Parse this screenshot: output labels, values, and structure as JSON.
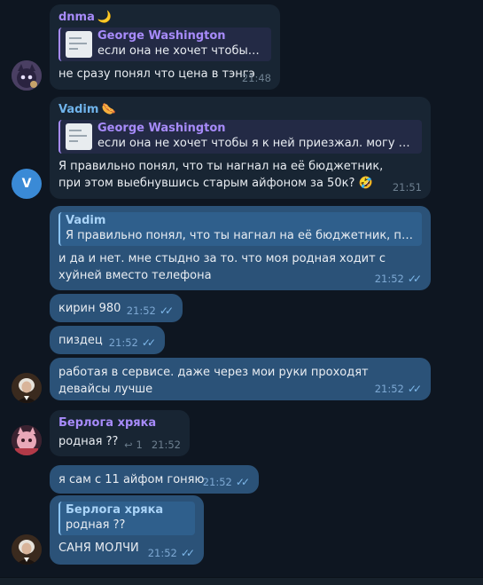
{
  "colors": {
    "background": "#0e1621",
    "incoming_bubble": "#182533",
    "outgoing_bubble": "#2b5278",
    "name_purple": "#a78bfa",
    "name_blue": "#6fb3ea",
    "read_check": "#7eb8ea"
  },
  "messages": [
    {
      "sender": "dnma",
      "sender_emoji": "🌙",
      "reply_name": "George Washington",
      "reply_text": "если она не хочет чтобы я к...",
      "text": "не сразу понял что цена в тэнгэ",
      "time": "21:48"
    },
    {
      "sender": "Vadim",
      "sender_emoji": "🌭",
      "avatar_letter": "V",
      "reply_name": "George Washington",
      "reply_text": "если она не хочет чтобы я к ней приезжал. могу ей 14 в...",
      "text": "Я правильно понял, что ты нагнал на её бюджетник, при этом выебнувшись старым айфоном за 50к? 🤣",
      "time": "21:51"
    },
    {
      "reply_name": "Vadim",
      "reply_text": "Я правильно понял, что ты нагнал на её бюджетник, при это...",
      "text": "и да и нет. мне стыдно за то. что моя родная ходит с хуйней вместо телефона",
      "time": "21:52",
      "check": "✓✓"
    },
    {
      "text": "кирин 980",
      "time": "21:52",
      "check": "✓✓"
    },
    {
      "text": "пиздец",
      "time": "21:52",
      "check": "✓✓"
    },
    {
      "text": "работая в сервисе. даже через мои руки проходят девайсы лучше",
      "time": "21:52",
      "check": "✓✓"
    },
    {
      "sender": "Берлога хряка",
      "text": "родная ??",
      "reply_count": "1",
      "reply_icon": "↩",
      "time": "21:52"
    },
    {
      "text": "я сам с 11 айфом гоняю",
      "time": "21:52",
      "check": "✓✓"
    },
    {
      "reply_name": "Берлога хряка",
      "reply_text": "родная ??",
      "text": "САНЯ МОЛЧИ",
      "time": "21:52",
      "check": "✓✓"
    }
  ]
}
